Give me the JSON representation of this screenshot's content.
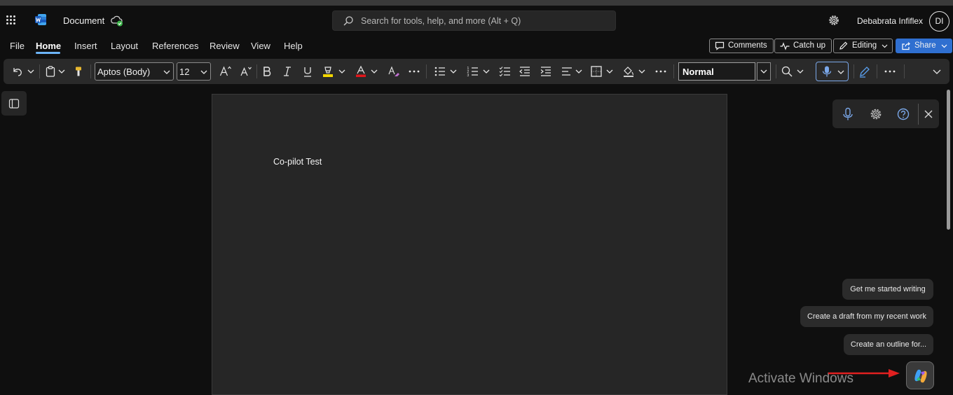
{
  "titlebar": {
    "doc_title": "Document",
    "search_placeholder": "Search for tools, help, and more (Alt + Q)",
    "user_name": "Debabrata Infiflex",
    "user_initials": "DI"
  },
  "tabs": [
    "File",
    "Home",
    "Insert",
    "Layout",
    "References",
    "Review",
    "View",
    "Help"
  ],
  "active_tab": "Home",
  "right_buttons": {
    "comments": "Comments",
    "catchup": "Catch up",
    "editing": "Editing",
    "share": "Share"
  },
  "ribbon": {
    "font_name": "Aptos (Body)",
    "font_size": "12",
    "style": "Normal"
  },
  "document": {
    "text": "Co-pilot Test"
  },
  "copilot_suggestions": [
    "Get me started writing",
    "Create a draft from my recent work",
    "Create an outline for..."
  ],
  "watermark": "Activate Windows",
  "colors": {
    "accent": "#6cb4f8",
    "share_bg": "#2f6fd0",
    "arrow": "#e02020",
    "highlight": "#f2d600",
    "font_color": "#e0161b"
  }
}
